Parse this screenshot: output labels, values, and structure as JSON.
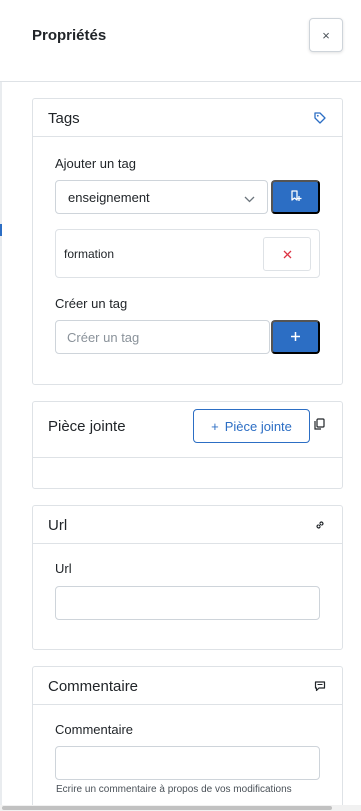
{
  "panel": {
    "title": "Propriétés",
    "close_symbol": "×"
  },
  "tags_card": {
    "title": "Tags",
    "icon": "tag-icon",
    "add_label": "Ajouter un tag",
    "select_value": "enseignement",
    "add_button_icon": "bookmark-plus-icon",
    "existing_tags": [
      {
        "label": "formation",
        "remove_symbol": "×"
      }
    ],
    "create_label": "Créer un tag",
    "create_placeholder": "Créer un tag",
    "create_button_symbol": "+"
  },
  "attachment_card": {
    "title": "Pièce jointe",
    "button_label": "Pièce jointe",
    "button_symbol": "+",
    "icon": "copy-icon"
  },
  "url_card": {
    "title": "Url",
    "icon": "link-icon",
    "field_label": "Url",
    "value": ""
  },
  "comment_card": {
    "title": "Commentaire",
    "icon": "comment-icon",
    "field_label": "Commentaire",
    "value": "",
    "help_text": "Ecrire un commentaire à propos de vos modifications"
  },
  "colors": {
    "primary": "#2c6ec4",
    "danger": "#dc3545",
    "border": "#dee2e6"
  }
}
